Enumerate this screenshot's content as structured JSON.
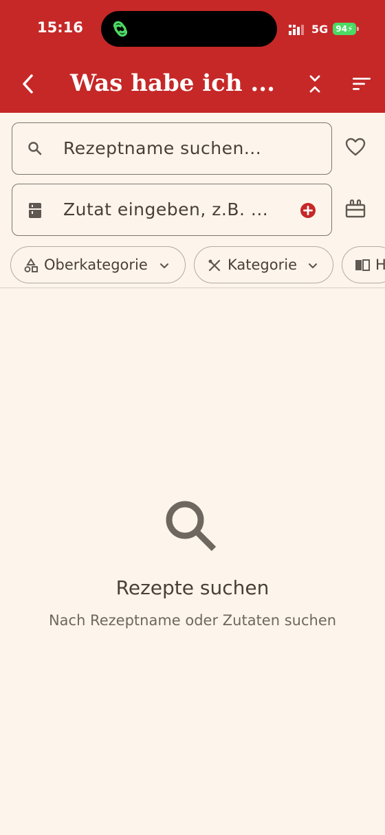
{
  "status_bar": {
    "time": "15:16",
    "network": "5G",
    "battery": "94"
  },
  "header": {
    "title": "Was habe ich ..."
  },
  "search": {
    "recipe_placeholder": "Rezeptname suchen...",
    "ingredient_placeholder": "Zutat eingeben, z.B. ..."
  },
  "filters": [
    {
      "label": "Oberkategorie",
      "icon": "shapes-icon"
    },
    {
      "label": "Kategorie",
      "icon": "cutlery-icon"
    },
    {
      "label": "H",
      "icon": "book-icon"
    }
  ],
  "empty_state": {
    "title": "Rezepte suchen",
    "subtitle": "Nach Rezeptname oder Zutaten suchen"
  },
  "colors": {
    "brand": "#c62828",
    "background": "#fdf5ec",
    "battery": "#4cd964",
    "accent_add": "#c62828"
  }
}
